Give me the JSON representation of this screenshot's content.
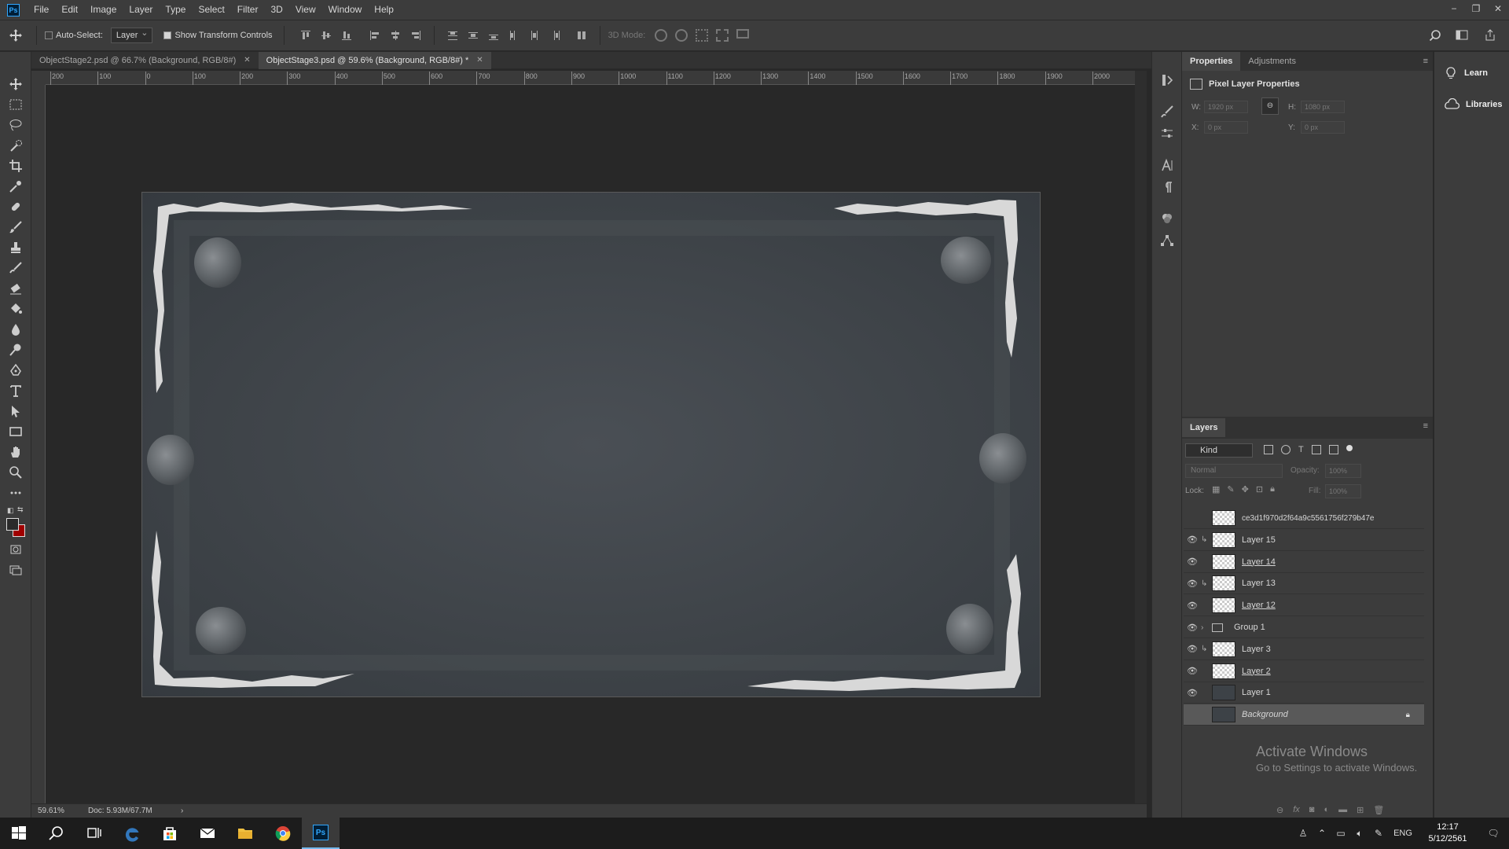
{
  "app": {
    "logo": "Ps"
  },
  "menu": [
    "File",
    "Edit",
    "Image",
    "Layer",
    "Type",
    "Select",
    "Filter",
    "3D",
    "View",
    "Window",
    "Help"
  ],
  "window_controls": [
    "−",
    "❐",
    "✕"
  ],
  "options": {
    "auto_select_label": "Auto-Select:",
    "auto_select_checked": false,
    "auto_select_value": "Layer",
    "transform_label": "Show Transform Controls",
    "transform_checked": true,
    "mode_3d_label": "3D Mode:"
  },
  "tabs": [
    {
      "label": "ObjectStage2.psd @ 66.7% (Background, RGB/8#)",
      "close": "✕",
      "active": false
    },
    {
      "label": "ObjectStage3.psd @ 59.6% (Background, RGB/8#) *",
      "close": "✕",
      "active": true
    }
  ],
  "ruler_top": [
    "200",
    "100",
    "0",
    "100",
    "200",
    "300",
    "400",
    "500",
    "600",
    "700",
    "800",
    "900",
    "1000",
    "1100",
    "1200",
    "1300",
    "1400",
    "1500",
    "1600",
    "1700",
    "1800",
    "1900",
    "2000"
  ],
  "status": {
    "zoom": "59.61%",
    "doc": "Doc: 5.93M/67.7M",
    "arrow": "›"
  },
  "properties": {
    "tab_active": "Properties",
    "tab_other": "Adjustments",
    "title": "Pixel Layer Properties",
    "w_label": "W:",
    "w_value": "1920 px",
    "h_label": "H:",
    "h_value": "1080 px",
    "x_label": "X:",
    "x_value": "0 px",
    "y_label": "Y:",
    "y_value": "0 px"
  },
  "layers_panel": {
    "title": "Layers",
    "kind": "Kind",
    "blend": "Normal",
    "opacity_label": "Opacity:",
    "opacity_value": "100%",
    "lock_label": "Lock:",
    "fill_label": "Fill:",
    "fill_value": "100%",
    "layers": [
      {
        "name": "ce3d1f970d2f64a9c5561756f279b47e",
        "visible": false,
        "clipped": false,
        "underline": false,
        "thumb": "smart",
        "selected": false
      },
      {
        "name": "Layer 15",
        "visible": true,
        "clipped": true,
        "underline": false,
        "thumb": "checker",
        "selected": false
      },
      {
        "name": "Layer 14",
        "visible": true,
        "clipped": false,
        "underline": true,
        "thumb": "checker",
        "selected": false
      },
      {
        "name": "Layer 13",
        "visible": true,
        "clipped": true,
        "underline": false,
        "thumb": "checker",
        "selected": false
      },
      {
        "name": "Layer 12",
        "visible": true,
        "clipped": false,
        "underline": true,
        "thumb": "checker",
        "selected": false
      },
      {
        "name": "Group 1",
        "visible": true,
        "clipped": false,
        "underline": false,
        "thumb": "folder",
        "selected": false
      },
      {
        "name": "Layer 3",
        "visible": true,
        "clipped": true,
        "underline": false,
        "thumb": "checker",
        "selected": false
      },
      {
        "name": "Layer 2",
        "visible": true,
        "clipped": false,
        "underline": true,
        "thumb": "checker",
        "selected": false
      },
      {
        "name": "Layer 1",
        "visible": true,
        "clipped": false,
        "underline": false,
        "thumb": "dark",
        "selected": false
      },
      {
        "name": "Background",
        "visible": false,
        "clipped": false,
        "underline": false,
        "thumb": "dark",
        "selected": true
      }
    ]
  },
  "learn": {
    "learn_label": "Learn",
    "libraries_label": "Libraries"
  },
  "activate": {
    "line1": "Activate Windows",
    "line2": "Go to Settings to activate Windows."
  },
  "taskbar": {
    "lang": "ENG",
    "time": "12:17",
    "date": "5/12/2561"
  }
}
